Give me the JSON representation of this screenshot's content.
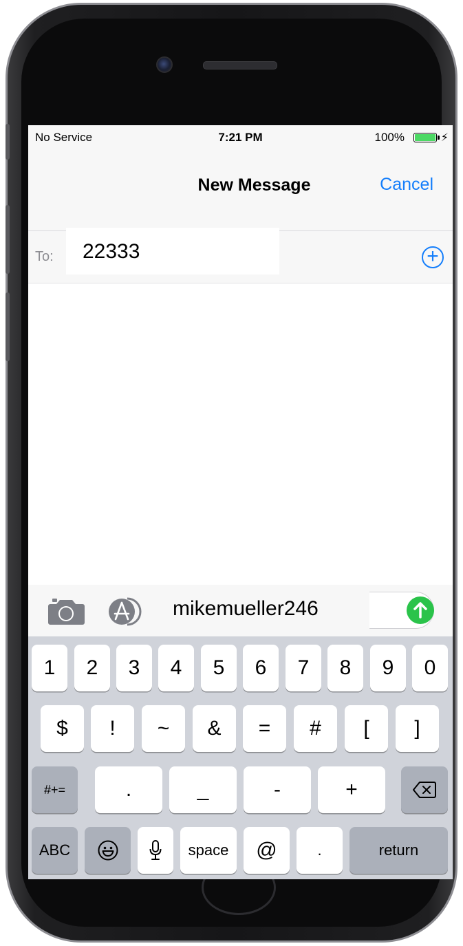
{
  "status_bar": {
    "carrier": "No Service",
    "time": "7:21 PM",
    "battery_percent": "100%",
    "battery_level": 1.0,
    "battery_color": "#4cd964",
    "charging_icon": "bolt-icon"
  },
  "nav": {
    "title": "New Message",
    "cancel_label": "Cancel",
    "accent_color": "#147efb"
  },
  "recipient": {
    "to_label": "To:",
    "value": "22333",
    "add_icon": "plus-circle-icon"
  },
  "composer": {
    "camera_icon": "camera-icon",
    "appstore_icon": "app-store-icon",
    "message_text": "mikemueller246",
    "send_icon": "arrow-up-icon",
    "send_color": "#2ac34a"
  },
  "keyboard": {
    "row1": [
      "1",
      "2",
      "3",
      "4",
      "5",
      "6",
      "7",
      "8",
      "9",
      "0"
    ],
    "row2": [
      "$",
      "!",
      "~",
      "&",
      "=",
      "#",
      "[",
      "]"
    ],
    "row3_toggle": "#+=",
    "row3": [
      ".",
      "_",
      "-",
      "+"
    ],
    "delete_icon": "backspace-icon",
    "abc_label": "ABC",
    "emoji_icon": "emoji-icon",
    "mic_icon": "microphone-icon",
    "space_label": "space",
    "at_label": "@",
    "dot_label": ".",
    "return_label": "return"
  }
}
